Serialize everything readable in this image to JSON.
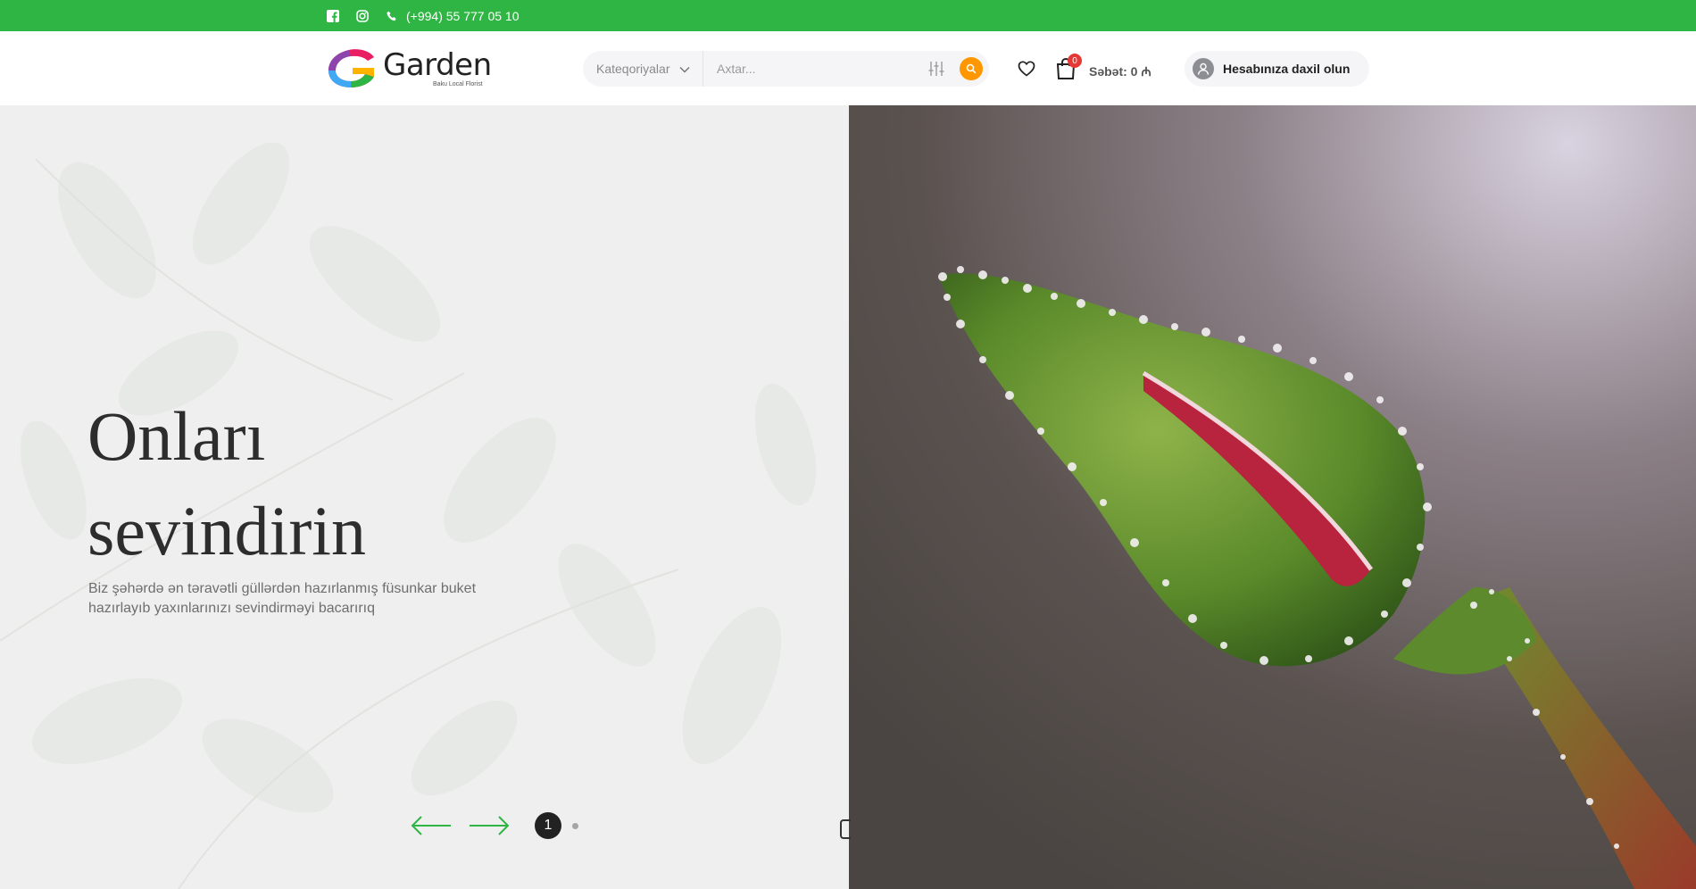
{
  "topbar": {
    "phone": "(+994) 55 777 05 10",
    "icons": [
      "facebook-icon",
      "instagram-icon",
      "phone-icon"
    ],
    "bg_color": "#2fb543"
  },
  "header": {
    "logo_name": "Garden",
    "logo_sub": "Baku Local Florist",
    "search": {
      "category_label": "Kateqoriyalar",
      "placeholder": "Axtar..."
    },
    "cart": {
      "count": "0",
      "label": "Səbət: 0 ₼"
    },
    "account_label": "Hesabınıza daxil olun",
    "accent_color": "#ff9800"
  },
  "hero": {
    "title_line1": "Onları",
    "title_line2": "sevindirin",
    "description": "Biz şəhərdə ən təravətli güllərdən hazırlanmış füsunkar buket hazırlayıb yaxınlarınızı sevindirməyi bacarırıq",
    "slider_current": "1"
  }
}
